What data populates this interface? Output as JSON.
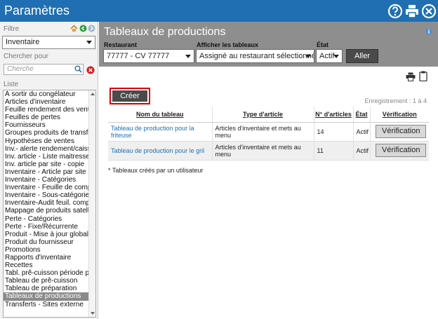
{
  "window": {
    "title": "Paramètres"
  },
  "sidebar": {
    "filter_label": "Filtre",
    "filter_value": "Inventaire",
    "search_label": "Chercher pour",
    "search_placeholder": "Cherche",
    "list_label": "Liste",
    "items": [
      "À sortir du congélateur",
      "Articles d'inventaire",
      "Feuille rendement des ventes",
      "Feuilles de pertes",
      "Fournisseurs",
      "Groupes produits de transfert",
      "Hypothèses de ventes",
      "Inv.- alerte rendement/caisse",
      "Inv. article - Liste maitresse",
      "Inv. article par site - copie",
      "Inventaire - Article par site",
      "Inventaire - Catégories",
      "Inventaire - Feuille de compte",
      "Inventaire - Sous-catégorie",
      "Inventaire-Audit feuil. compte",
      "Mappage de produits satellite",
      "Perte - Catégories",
      "Perte - Fixe/Récurrente",
      "Produit - Mise à jour globale",
      "Produit du fournisseur",
      "Promotions",
      "Rapports d'inventaire",
      "Recettes",
      "Tabl. prê-cuisson période pers",
      "Tableau de prê-cuisson",
      "Tableau de préparation",
      "Tableaux de productions",
      "Transferts - Sites externe"
    ],
    "selected_index": 26
  },
  "main": {
    "title": "Tableaux de productions",
    "filters": {
      "restaurant_label": "Restaurant",
      "restaurant_value": "77777 - CV 77777",
      "show_label": "Afficher les tableaux",
      "show_value": "Assigné au restaurant sélectionné",
      "state_label": "État",
      "state_value": "Actif",
      "go_label": "Aller"
    },
    "create_label": "Créer",
    "record_text": "Enregistrement : 1 à 4",
    "table": {
      "headers": [
        "Nom du tableau",
        "Type d'article",
        "N° d'articles",
        "État",
        "Vérification"
      ],
      "rows": [
        {
          "name": "Tableau de production pour la friteuse",
          "type": "Articles d'inventaire et mets au menu",
          "count": "14",
          "state": "Actif",
          "verify": "Vérification"
        },
        {
          "name": "Tableau de production pour le gril",
          "type": "Articles d'inventaire et mets au menu",
          "count": "11",
          "state": "Actif",
          "verify": "Vérification"
        }
      ]
    },
    "footnote": "* Tableaux créés par un utilisateur"
  },
  "colors": {
    "titlebar": "#1f6fb2",
    "banner": "#8e8e8e",
    "highlight_border": "#d40000",
    "link": "#1f6fb2"
  },
  "icons": [
    "help-icon",
    "print-icon",
    "close-icon",
    "home-icon",
    "back-icon",
    "forward-icon",
    "search-icon",
    "clear-icon",
    "info-icon",
    "clipboard-icon"
  ]
}
